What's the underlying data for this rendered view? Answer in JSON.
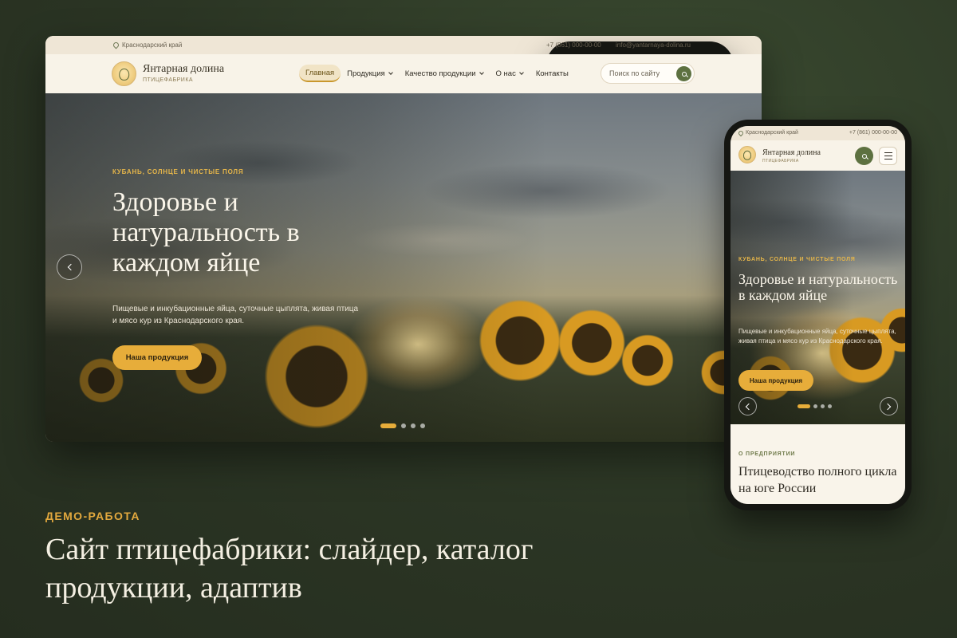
{
  "desktop": {
    "topbar": {
      "location": "Краснодарский край",
      "phone": "+7 (861) 000-00-00",
      "email": "info@yantarnaya-dolina.ru"
    },
    "logo": {
      "title": "Янтарная долина",
      "subtitle": "ПТИЦЕФАБРИКА"
    },
    "nav": [
      {
        "label": "Главная",
        "active": true
      },
      {
        "label": "Продукция",
        "dropdown": true
      },
      {
        "label": "Качество продукции",
        "dropdown": true
      },
      {
        "label": "О нас",
        "dropdown": true
      },
      {
        "label": "Контакты"
      }
    ],
    "search": {
      "placeholder": "Поиск по сайту"
    },
    "hero": {
      "eyebrow": "КУБАНЬ, СОЛНЦЕ И ЧИСТЫЕ ПОЛЯ",
      "title": "Здоровье и натуральность в каждом яйце",
      "text": "Пищевые и инкубационные яйца, суточные цыплята, живая птица и мясо кур из Краснодарского края.",
      "button": "Наша продукция",
      "slides_total": 4,
      "active_slide": 1
    }
  },
  "mobile": {
    "topbar": {
      "location": "Краснодарский край",
      "phone": "+7 (861) 000-00-00"
    },
    "logo": {
      "title": "Янтарная долина",
      "subtitle": "ПТИЦЕФАБРИКА"
    },
    "hero": {
      "eyebrow": "КУБАНЬ, СОЛНЦЕ И ЧИСТЫЕ ПОЛЯ",
      "title": "Здоровье и натуральность в каждом яйце",
      "text": "Пищевые и инкубационные яйца, суточные цыплята, живая птица и мясо кур из Краснодарского края.",
      "button": "Наша продукция",
      "slides_total": 4,
      "active_slide": 1
    },
    "about": {
      "eyebrow": "О ПРЕДПРИЯТИИ",
      "title": "Птицеводство полного цикла на юге России"
    }
  },
  "caption": {
    "eyebrow": "ДЕМО-РАБОТА",
    "title": "Сайт птицефабрики: слайдер, каталог продукции, адаптив"
  },
  "colors": {
    "accent": "#e7ad3a",
    "brand_green": "#5d7140",
    "background": "#2b3524",
    "cream": "#f7f1e5"
  }
}
